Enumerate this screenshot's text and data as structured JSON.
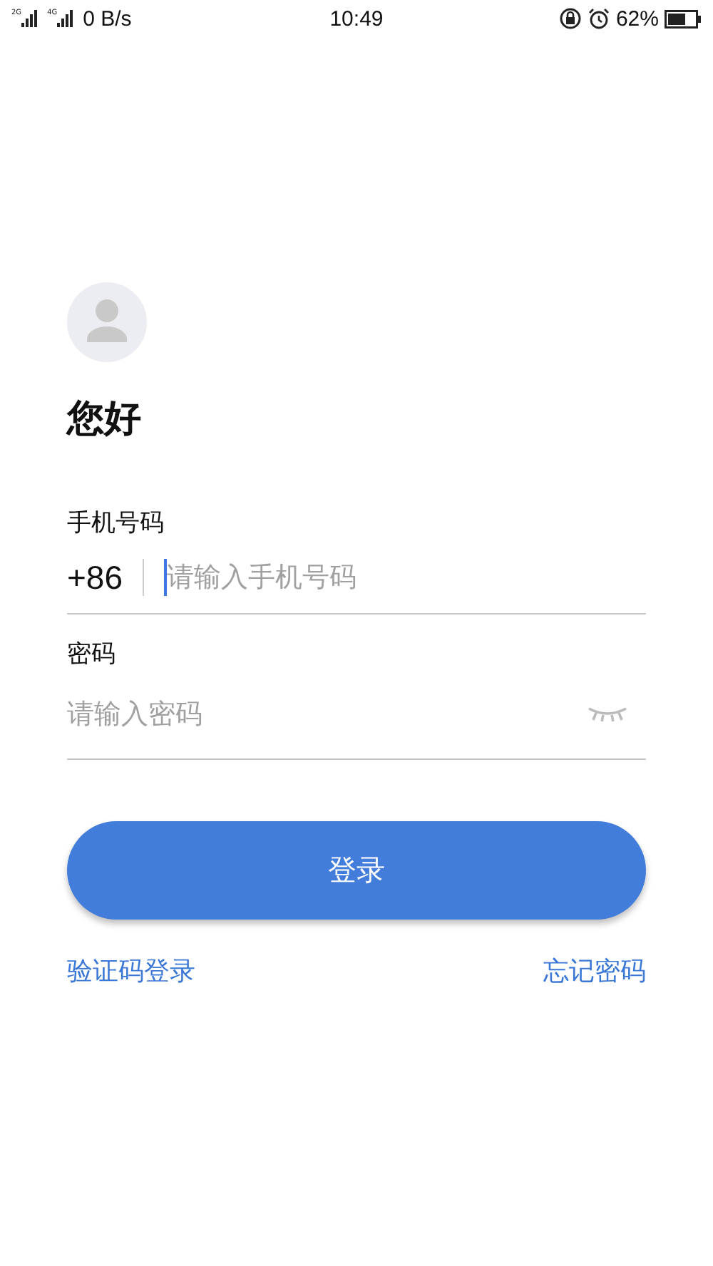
{
  "status_bar": {
    "network_labels": [
      "2G",
      "4G"
    ],
    "speed": "0 B/s",
    "time": "10:49",
    "battery": "62%"
  },
  "greeting": "您好",
  "phone": {
    "label": "手机号码",
    "country_code": "+86",
    "placeholder": "请输入手机号码",
    "focused": true
  },
  "password": {
    "label": "密码",
    "placeholder": "请输入密码",
    "visible": false
  },
  "login_button": "登录",
  "links": [
    "验证码登录",
    "忘记密码"
  ]
}
